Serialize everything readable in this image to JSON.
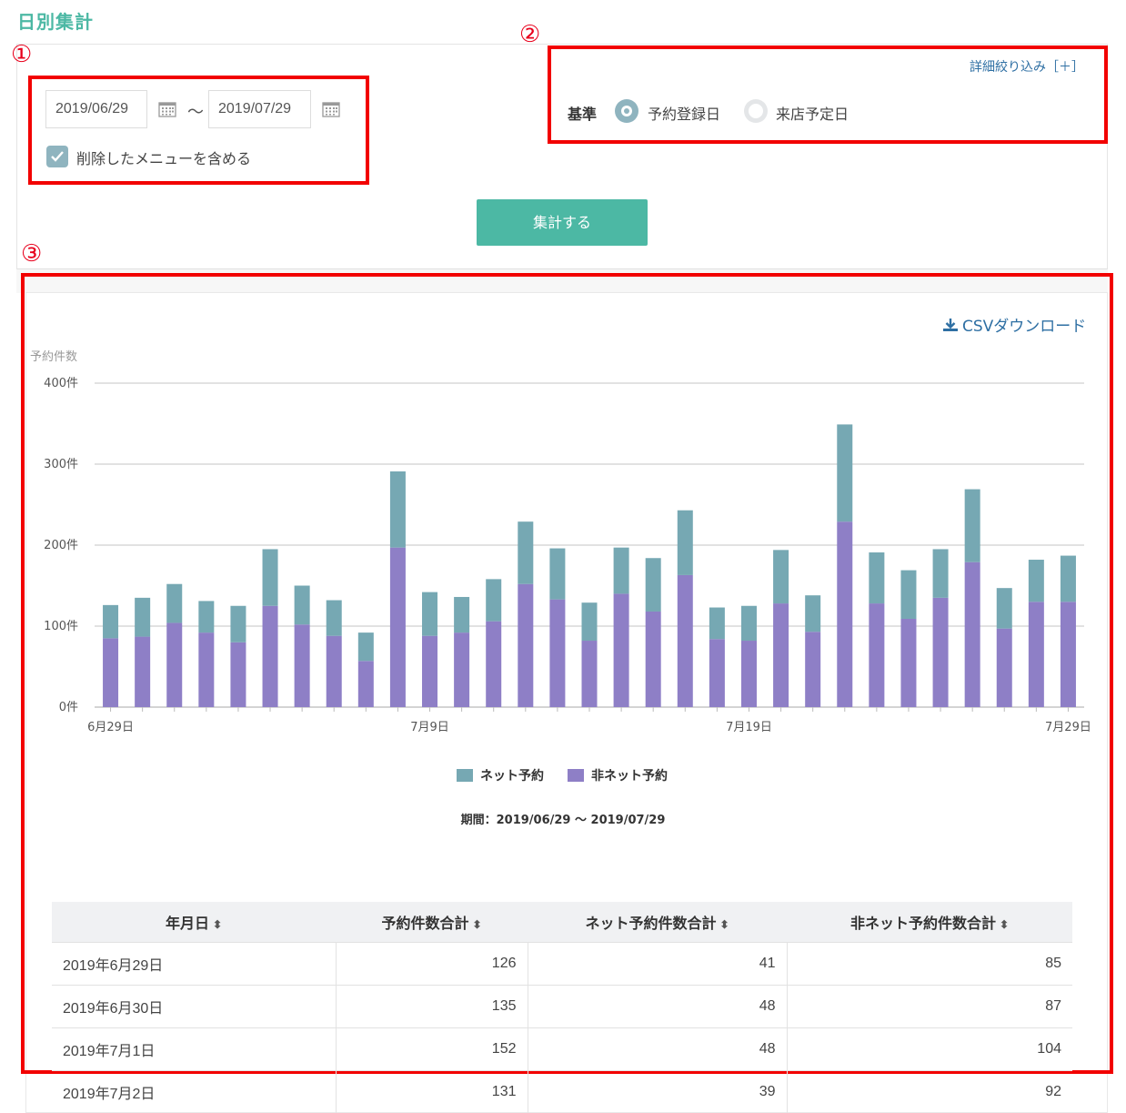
{
  "page": {
    "title": "日別集計"
  },
  "markers": [
    "①",
    "②",
    "③"
  ],
  "filters": {
    "date_from": "2019/06/29",
    "date_to": "2019/07/29",
    "tilde": "～",
    "include_deleted_label": "削除したメニューを含める",
    "include_deleted_checked": true,
    "detail_filter_link": "詳細絞り込み［＋］",
    "basis_label": "基準",
    "basis_options": [
      {
        "label": "予約登録日",
        "selected": true
      },
      {
        "label": "来店予定日",
        "selected": false
      }
    ],
    "submit_label": "集計する"
  },
  "result": {
    "csv_label": "CSVダウンロード",
    "period_text": "期間：2019/06/29 ～ 2019/07/29"
  },
  "chart_data": {
    "type": "bar",
    "stacked": true,
    "ylabel": "予約件数",
    "ylim": [
      0,
      400
    ],
    "yticks": [
      "0件",
      "100件",
      "200件",
      "300件",
      "400件"
    ],
    "xtick_labels": [
      {
        "index": 0,
        "label": "6月29日"
      },
      {
        "index": 10,
        "label": "7月9日"
      },
      {
        "index": 20,
        "label": "7月19日"
      },
      {
        "index": 30,
        "label": "7月29日"
      }
    ],
    "categories": [
      "6/29",
      "6/30",
      "7/1",
      "7/2",
      "7/3",
      "7/4",
      "7/5",
      "7/6",
      "7/7",
      "7/8",
      "7/9",
      "7/10",
      "7/11",
      "7/12",
      "7/13",
      "7/14",
      "7/15",
      "7/16",
      "7/17",
      "7/18",
      "7/19",
      "7/20",
      "7/21",
      "7/22",
      "7/23",
      "7/24",
      "7/25",
      "7/26",
      "7/27",
      "7/28",
      "7/29"
    ],
    "series": [
      {
        "name": "非ネット予約",
        "color": "#8e7fc6",
        "values": [
          85,
          87,
          104,
          92,
          80,
          125,
          102,
          88,
          57,
          197,
          88,
          92,
          106,
          152,
          133,
          82,
          140,
          118,
          163,
          84,
          82,
          128,
          93,
          229,
          128,
          109,
          135,
          179,
          97,
          130,
          130
        ]
      },
      {
        "name": "ネット予約",
        "color": "#76a8b3",
        "values": [
          41,
          48,
          48,
          39,
          45,
          70,
          48,
          44,
          35,
          94,
          54,
          44,
          52,
          77,
          63,
          47,
          57,
          66,
          80,
          39,
          43,
          66,
          45,
          120,
          63,
          60,
          60,
          90,
          50,
          52,
          57
        ]
      }
    ],
    "legend": [
      {
        "name": "ネット予約",
        "color": "#76a8b3"
      },
      {
        "name": "非ネット予約",
        "color": "#8e7fc6"
      }
    ],
    "grid": true
  },
  "table": {
    "headers": [
      "年月日",
      "予約件数合計",
      "ネット予約件数合計",
      "非ネット予約件数合計"
    ],
    "sort_icon": "⬍",
    "rows": [
      [
        "2019年6月29日",
        "126",
        "41",
        "85"
      ],
      [
        "2019年6月30日",
        "135",
        "48",
        "87"
      ],
      [
        "2019年7月1日",
        "152",
        "48",
        "104"
      ],
      [
        "2019年7月2日",
        "131",
        "39",
        "92"
      ]
    ]
  }
}
